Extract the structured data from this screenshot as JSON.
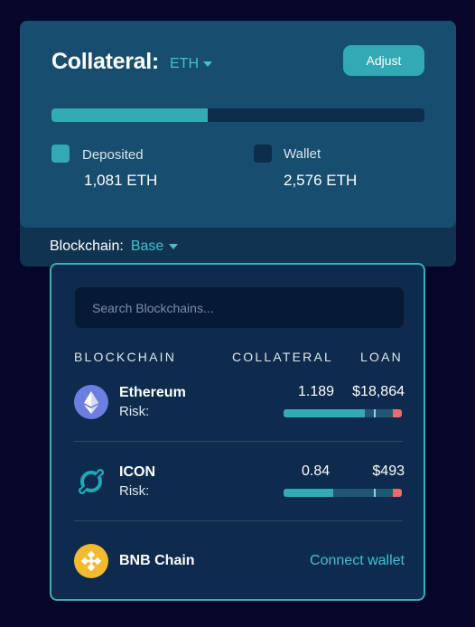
{
  "collateral": {
    "title": "Collateral:",
    "asset": "ETH",
    "adjust_label": "Adjust",
    "deposited_fraction": 0.42,
    "deposited_label": "Deposited",
    "deposited_value": "1,081 ETH",
    "wallet_label": "Wallet",
    "wallet_value": "2,576 ETH"
  },
  "blockchain_selector": {
    "label": "Blockchain:",
    "selected": "Base"
  },
  "dropdown": {
    "search_placeholder": "Search Blockchains...",
    "columns": [
      "BLOCKCHAIN",
      "COLLATERAL",
      "LOAN"
    ],
    "rows": [
      {
        "name": "Ethereum",
        "risk_label": "Risk:",
        "collateral": "1.189",
        "loan": "$18,864",
        "risk_fraction": 0.69,
        "icon": "ethereum-icon"
      },
      {
        "name": "ICON",
        "risk_label": "Risk:",
        "collateral": "0.84",
        "loan": "$493",
        "risk_fraction": 0.42,
        "icon": "icon-chain-icon"
      },
      {
        "name": "BNB Chain",
        "action": "Connect wallet",
        "icon": "bnb-icon"
      }
    ]
  },
  "colors": {
    "accent": "#3fc3cf",
    "danger": "#e76c6c",
    "background": "#06062a"
  }
}
